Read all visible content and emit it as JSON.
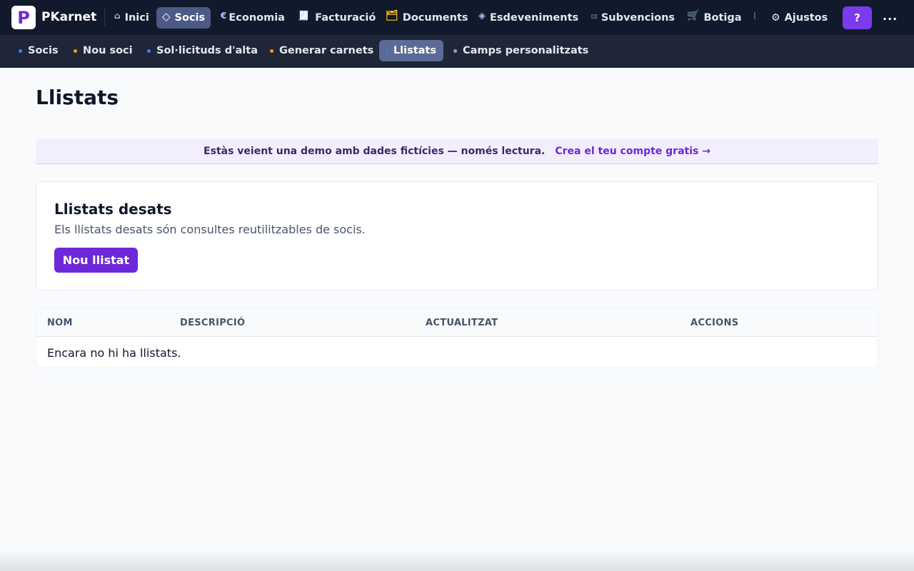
{
  "app": {
    "name": "PKarnet",
    "logo_letter": "P",
    "logo_color": "#6d28d9"
  },
  "topnav": {
    "items": [
      {
        "label": "Inici",
        "icon": "⌂"
      },
      {
        "label": "Socis",
        "icon": "◇",
        "active": true
      },
      {
        "label": "Economia",
        "icon": "€"
      },
      {
        "label": "Facturació",
        "icon": "🧾"
      },
      {
        "label": "Documents",
        "icon": "🗂"
      },
      {
        "label": "Esdeveniments",
        "icon": "◈"
      },
      {
        "label": "Subvencions",
        "icon": "▯▯"
      },
      {
        "label": "Botiga",
        "icon": "🛒"
      }
    ],
    "settings_label": "Ajustos",
    "settings_icon": "⚙",
    "help_label": "?",
    "more_label": "...",
    "accent": "#7c3aed"
  },
  "subnav": {
    "items": [
      {
        "label": "Socis",
        "dot_color": "#3b82f6"
      },
      {
        "label": "Nou soci",
        "dot_color": "#f59e0b"
      },
      {
        "label": "Sol·licituds d'alta",
        "dot_color": "#3b82f6"
      },
      {
        "label": "Generar carnets",
        "dot_color": "#f59e0b"
      },
      {
        "label": "Llistats",
        "dot_color": "#3b82f6",
        "active": true
      },
      {
        "label": "Camps personalitzats",
        "dot_color": "#94a3b8"
      }
    ]
  },
  "page": {
    "title": "Llistats"
  },
  "banner": {
    "text": "Estàs veient una demo amb dades fictícies — només lectura.",
    "link": "Crea el teu compte gratis →"
  },
  "card": {
    "title": "Llistats desats",
    "description": "Els llistats desats són consultes reutilitzables de socis.",
    "button": "Nou llistat"
  },
  "table": {
    "columns": [
      "NOM",
      "DESCRIPCIÓ",
      "ACTUALITZAT",
      "ACCIONS"
    ],
    "empty_message": "Encara no hi ha llistats."
  }
}
